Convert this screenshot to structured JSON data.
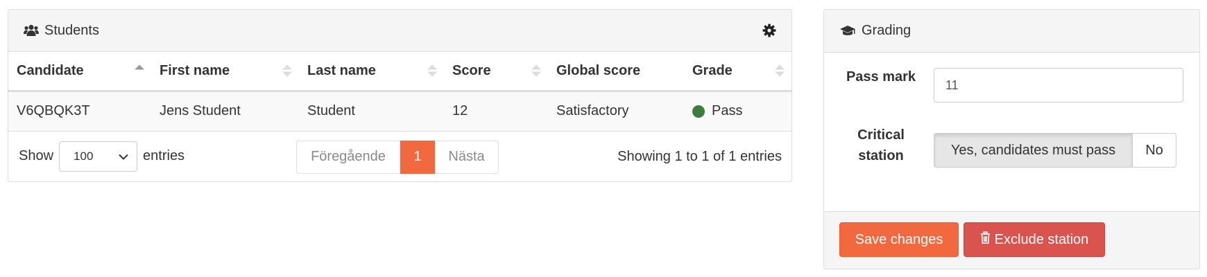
{
  "students": {
    "title": "Students",
    "columns": [
      "Candidate",
      "First name",
      "Last name",
      "Score",
      "Global score",
      "Grade"
    ],
    "rows": [
      {
        "candidate": "V6QBQK3T",
        "first_name": "Jens Student",
        "last_name": "Student",
        "score": "12",
        "global_score": "Satisfactory",
        "grade": "Pass"
      }
    ],
    "length": {
      "show_label": "Show",
      "selected": "100",
      "entries_label": "entries"
    },
    "pagination": {
      "prev": "Föregående",
      "current": "1",
      "next": "Nästa"
    },
    "info": "Showing 1 to 1 of 1 entries"
  },
  "grading": {
    "title": "Grading",
    "pass_mark_label": "Pass mark",
    "pass_mark_value": "11",
    "critical_label": "Critical station",
    "critical_yes": "Yes, candidates must pass",
    "critical_no": "No",
    "save_label": "Save changes",
    "exclude_label": "Exclude station"
  },
  "colors": {
    "accent": "#f2693f",
    "danger": "#d9534f",
    "pass": "#3a7d3e"
  },
  "icons": {
    "students": "users-icon",
    "settings": "gear-icon",
    "grading": "graduation-cap-icon",
    "exclude": "trash-icon"
  }
}
